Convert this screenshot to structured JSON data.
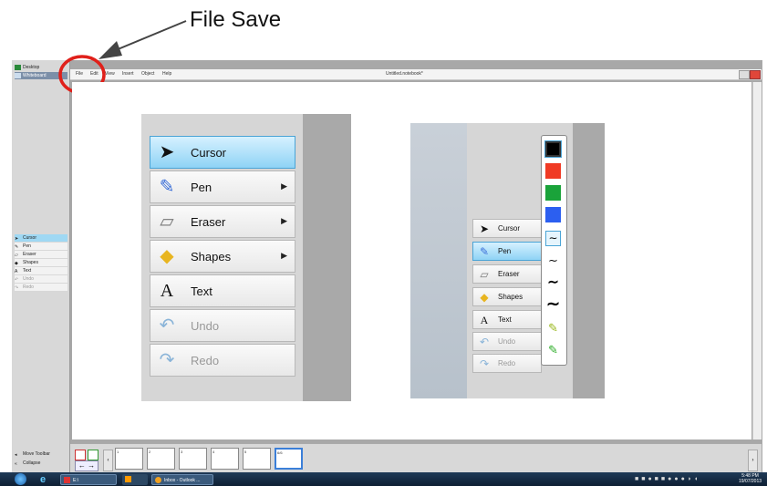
{
  "annotation": {
    "text": "File Save"
  },
  "left_panel": {
    "top_items": [
      "Desktop",
      "Whiteboard"
    ],
    "tools": [
      "Cursor",
      "Pen",
      "Eraser",
      "Shapes",
      "Text",
      "Undo",
      "Redo"
    ],
    "bottom_items": [
      "Move Toolbar",
      "Collapse"
    ]
  },
  "menubar": {
    "items": [
      "File",
      "Edit",
      "View",
      "Insert",
      "Object",
      "Help"
    ],
    "title": "Untitled.notebook*"
  },
  "big_toolbar": {
    "items": [
      {
        "label": "Cursor",
        "icon": "cursor-icon"
      },
      {
        "label": "Pen",
        "icon": "pen-icon"
      },
      {
        "label": "Eraser",
        "icon": "eraser-icon"
      },
      {
        "label": "Shapes",
        "icon": "shapes-icon"
      },
      {
        "label": "Text",
        "icon": "text-icon"
      },
      {
        "label": "Undo",
        "icon": "undo-icon"
      },
      {
        "label": "Redo",
        "icon": "redo-icon"
      }
    ]
  },
  "small_toolbar": {
    "items": [
      "Cursor",
      "Pen",
      "Eraser",
      "Shapes",
      "Text",
      "Undo",
      "Redo"
    ]
  },
  "palette": {
    "colors": [
      "#000000",
      "#f03a24",
      "#1aa33a",
      "#2c5ff0"
    ],
    "highlighter_colors": [
      "#c9e23a",
      "#3ecf3a"
    ]
  },
  "pages": [
    "1",
    "2",
    "3",
    "4",
    "5",
    "6/6"
  ],
  "taskbar": {
    "apps": [
      "E:\\",
      "Inbox - Outlook ..."
    ],
    "time": "5:48 PM",
    "date": "19/07/2013"
  },
  "colors": {
    "selected": "#8fd3f5",
    "annotation_circle": "#e0201a",
    "taskbar": "#1f3a57"
  }
}
